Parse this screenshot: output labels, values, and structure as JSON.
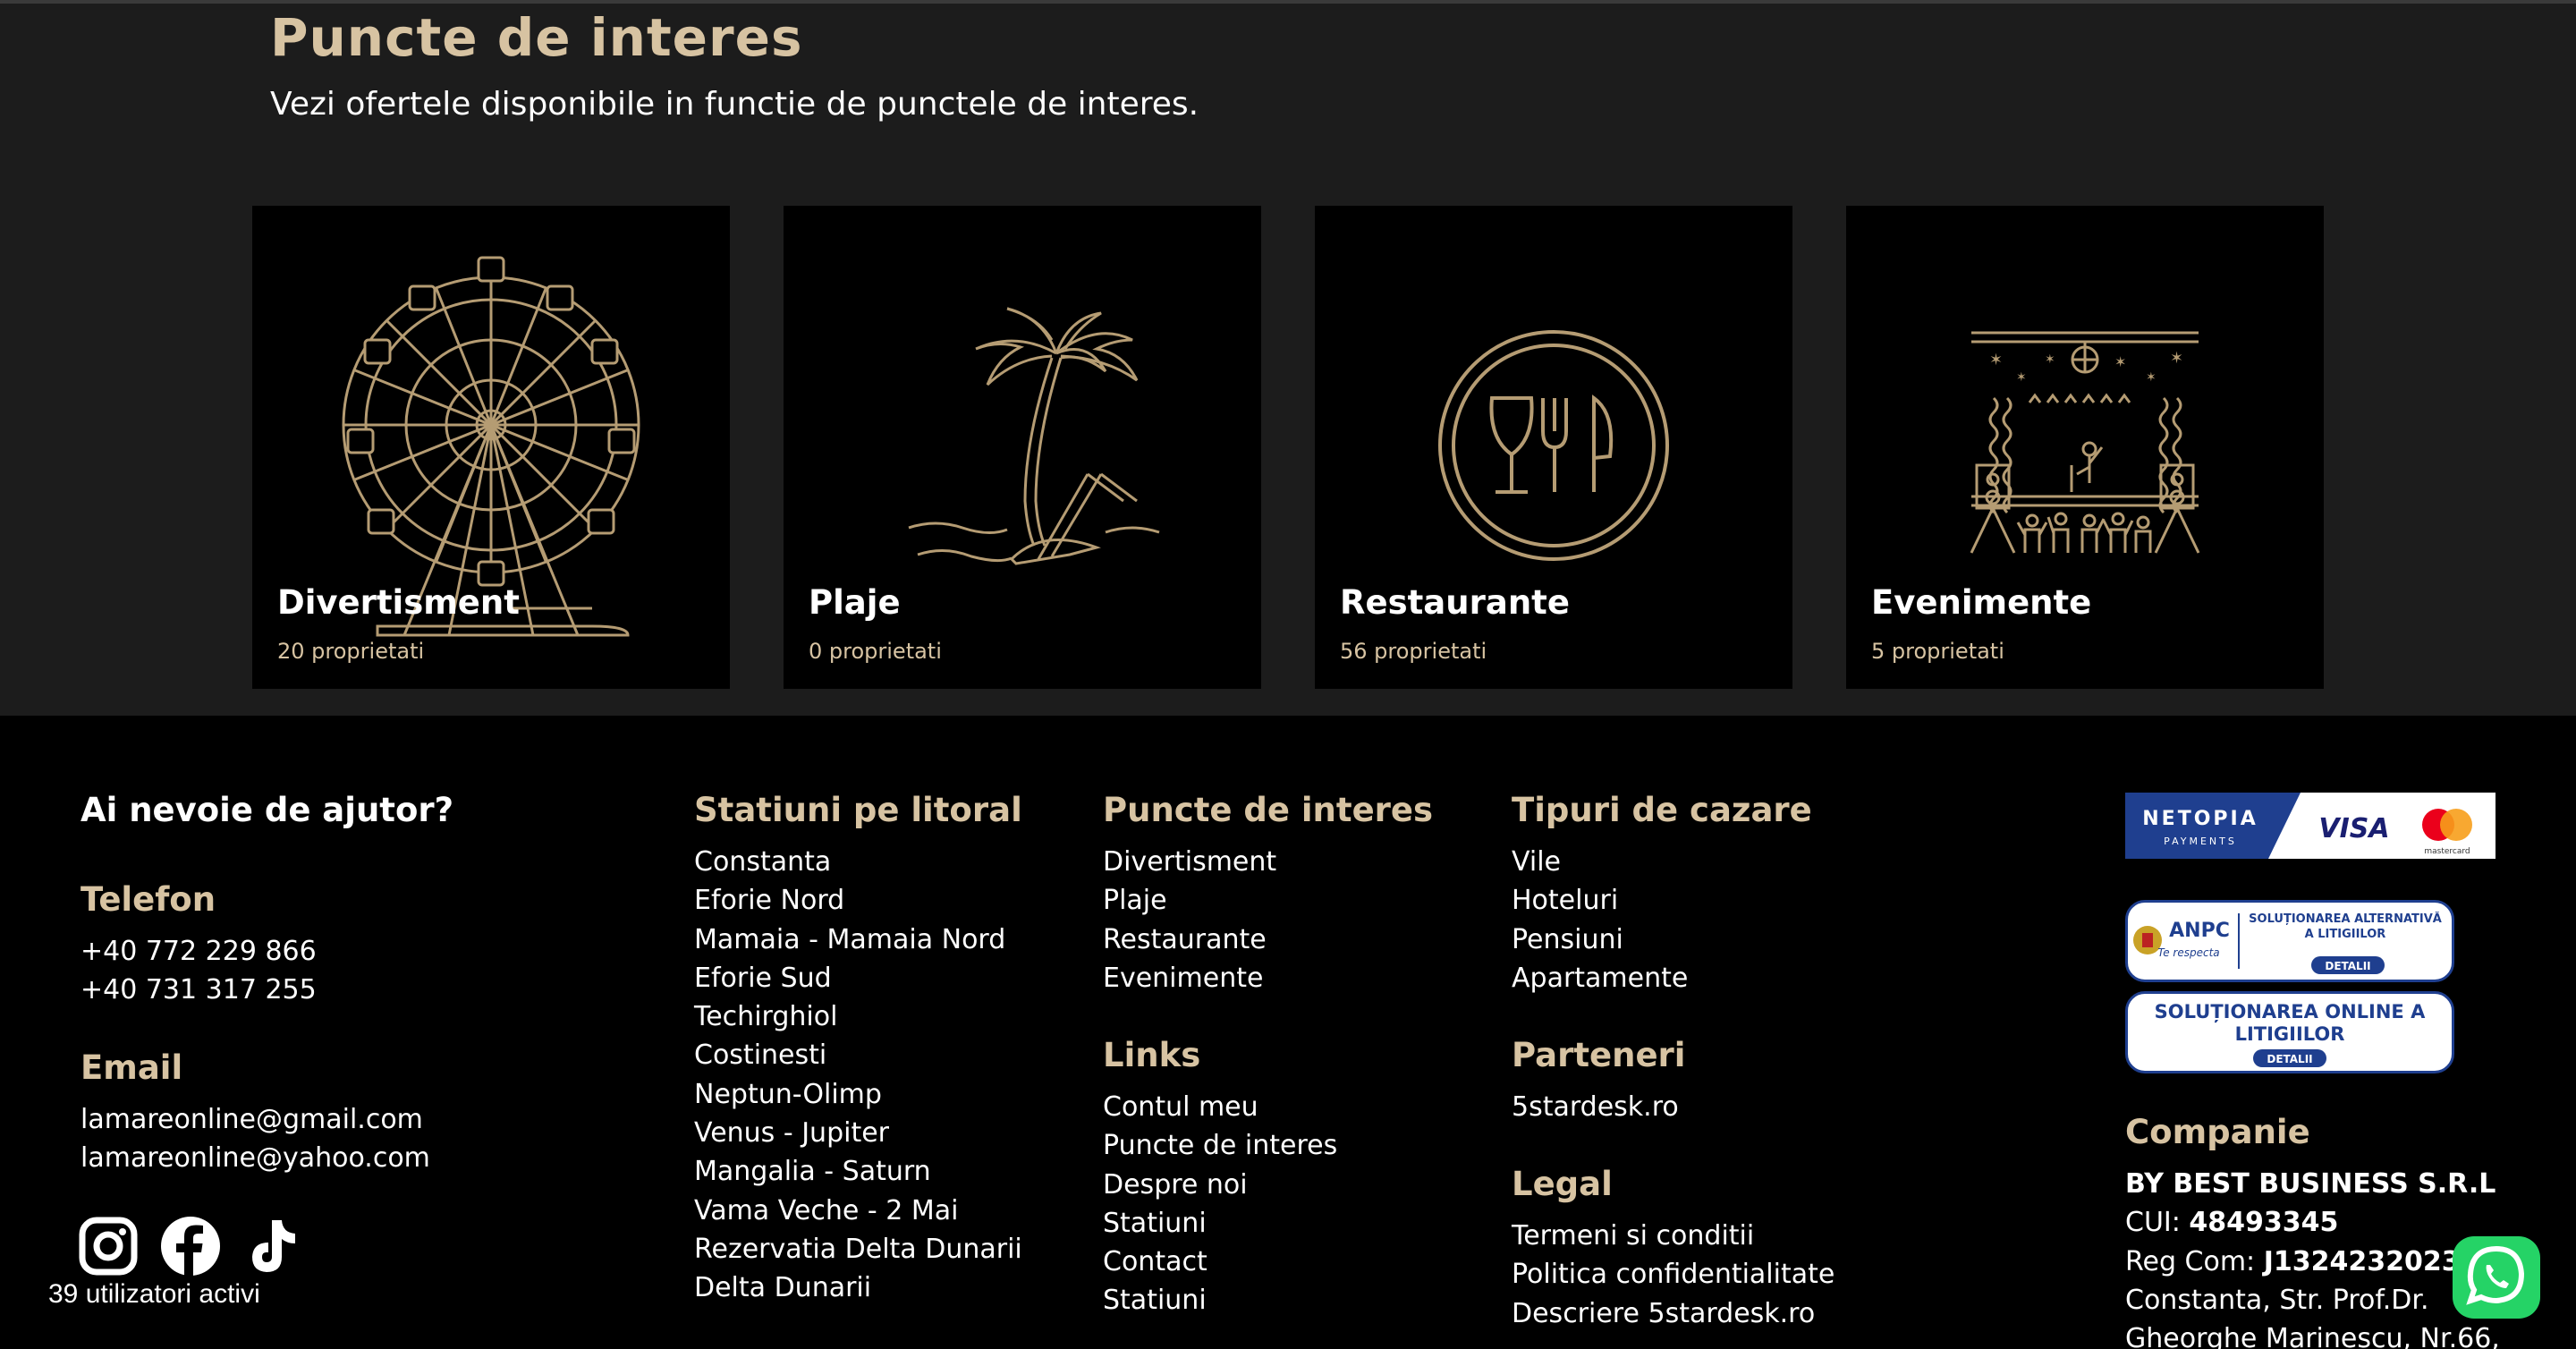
{
  "section": {
    "title": "Puncte de interes",
    "subtitle": "Vezi ofertele disponibile in functie de punctele de interes."
  },
  "cards": [
    {
      "title": "Divertisment",
      "count": "20 proprietati",
      "icon": "ferris-wheel-icon"
    },
    {
      "title": "Plaje",
      "count": "0 proprietati",
      "icon": "palm-beach-icon"
    },
    {
      "title": "Restaurante",
      "count": "56 proprietati",
      "icon": "plate-cutlery-icon"
    },
    {
      "title": "Evenimente",
      "count": "5 proprietati",
      "icon": "stage-concert-icon"
    }
  ],
  "footer": {
    "help": {
      "title": "Ai nevoie de ajutor?",
      "phone_title": "Telefon",
      "phones": [
        "+40 772 229 866",
        "+40 731 317 255"
      ],
      "email_title": "Email",
      "emails": [
        "lamareonline@gmail.com",
        "lamareonline@yahoo.com"
      ]
    },
    "stations": {
      "title": "Statiuni pe litoral",
      "items": [
        "Constanta",
        "Eforie Nord",
        "Mamaia - Mamaia Nord",
        "Eforie Sud",
        "Techirghiol",
        "Costinesti",
        "Neptun-Olimp",
        "Venus - Jupiter",
        "Mangalia - Saturn",
        "Vama Veche - 2 Mai",
        "Rezervatia Delta Dunarii",
        "Delta Dunarii"
      ]
    },
    "poi": {
      "title": "Puncte de interes",
      "items": [
        "Divertisment",
        "Plaje",
        "Restaurante",
        "Evenimente"
      ]
    },
    "links": {
      "title": "Links",
      "items": [
        "Contul meu",
        "Puncte de interes",
        "Despre noi",
        "Statiuni",
        "Contact",
        "Statiuni"
      ]
    },
    "lodging": {
      "title": "Tipuri de cazare",
      "items": [
        "Vile",
        "Hoteluri",
        "Pensiuni",
        "Apartamente"
      ]
    },
    "partners": {
      "title": "Parteneri",
      "items": [
        "5stardesk.ro"
      ]
    },
    "legal": {
      "title": "Legal",
      "items": [
        "Termeni si conditii",
        "Politica confidentialitate",
        "Descriere 5stardesk.ro"
      ]
    },
    "company": {
      "title": "Companie",
      "name": "BY BEST BUSINESS S.R.L",
      "cui_label": "CUI: ",
      "cui": "48493345",
      "reg_label": "Reg Com: ",
      "reg": "J1324232023",
      "address1": "Constanta, Str. Prof.Dr.",
      "address2": "Gheorghe Marinescu, Nr.66,"
    },
    "payment": {
      "netopia": "NETOPIA",
      "netopia_sub": "PAYMENTS",
      "visa": "VISA",
      "mastercard": "mastercard"
    },
    "anpc": {
      "anpc": "ANPC",
      "tagline": "Te respecta",
      "sal": "SOLUȚIONAREA ALTERNATIVĂ A LITIGIILOR",
      "sol": "SOLUȚIONAREA ONLINE A LITIGIILOR",
      "detalii": "DETALII"
    },
    "active_users": "39 utilizatori activi"
  },
  "colors": {
    "accent": "#d7c3a2",
    "gold_line": "#b59c73",
    "whatsapp": "#25d366"
  }
}
